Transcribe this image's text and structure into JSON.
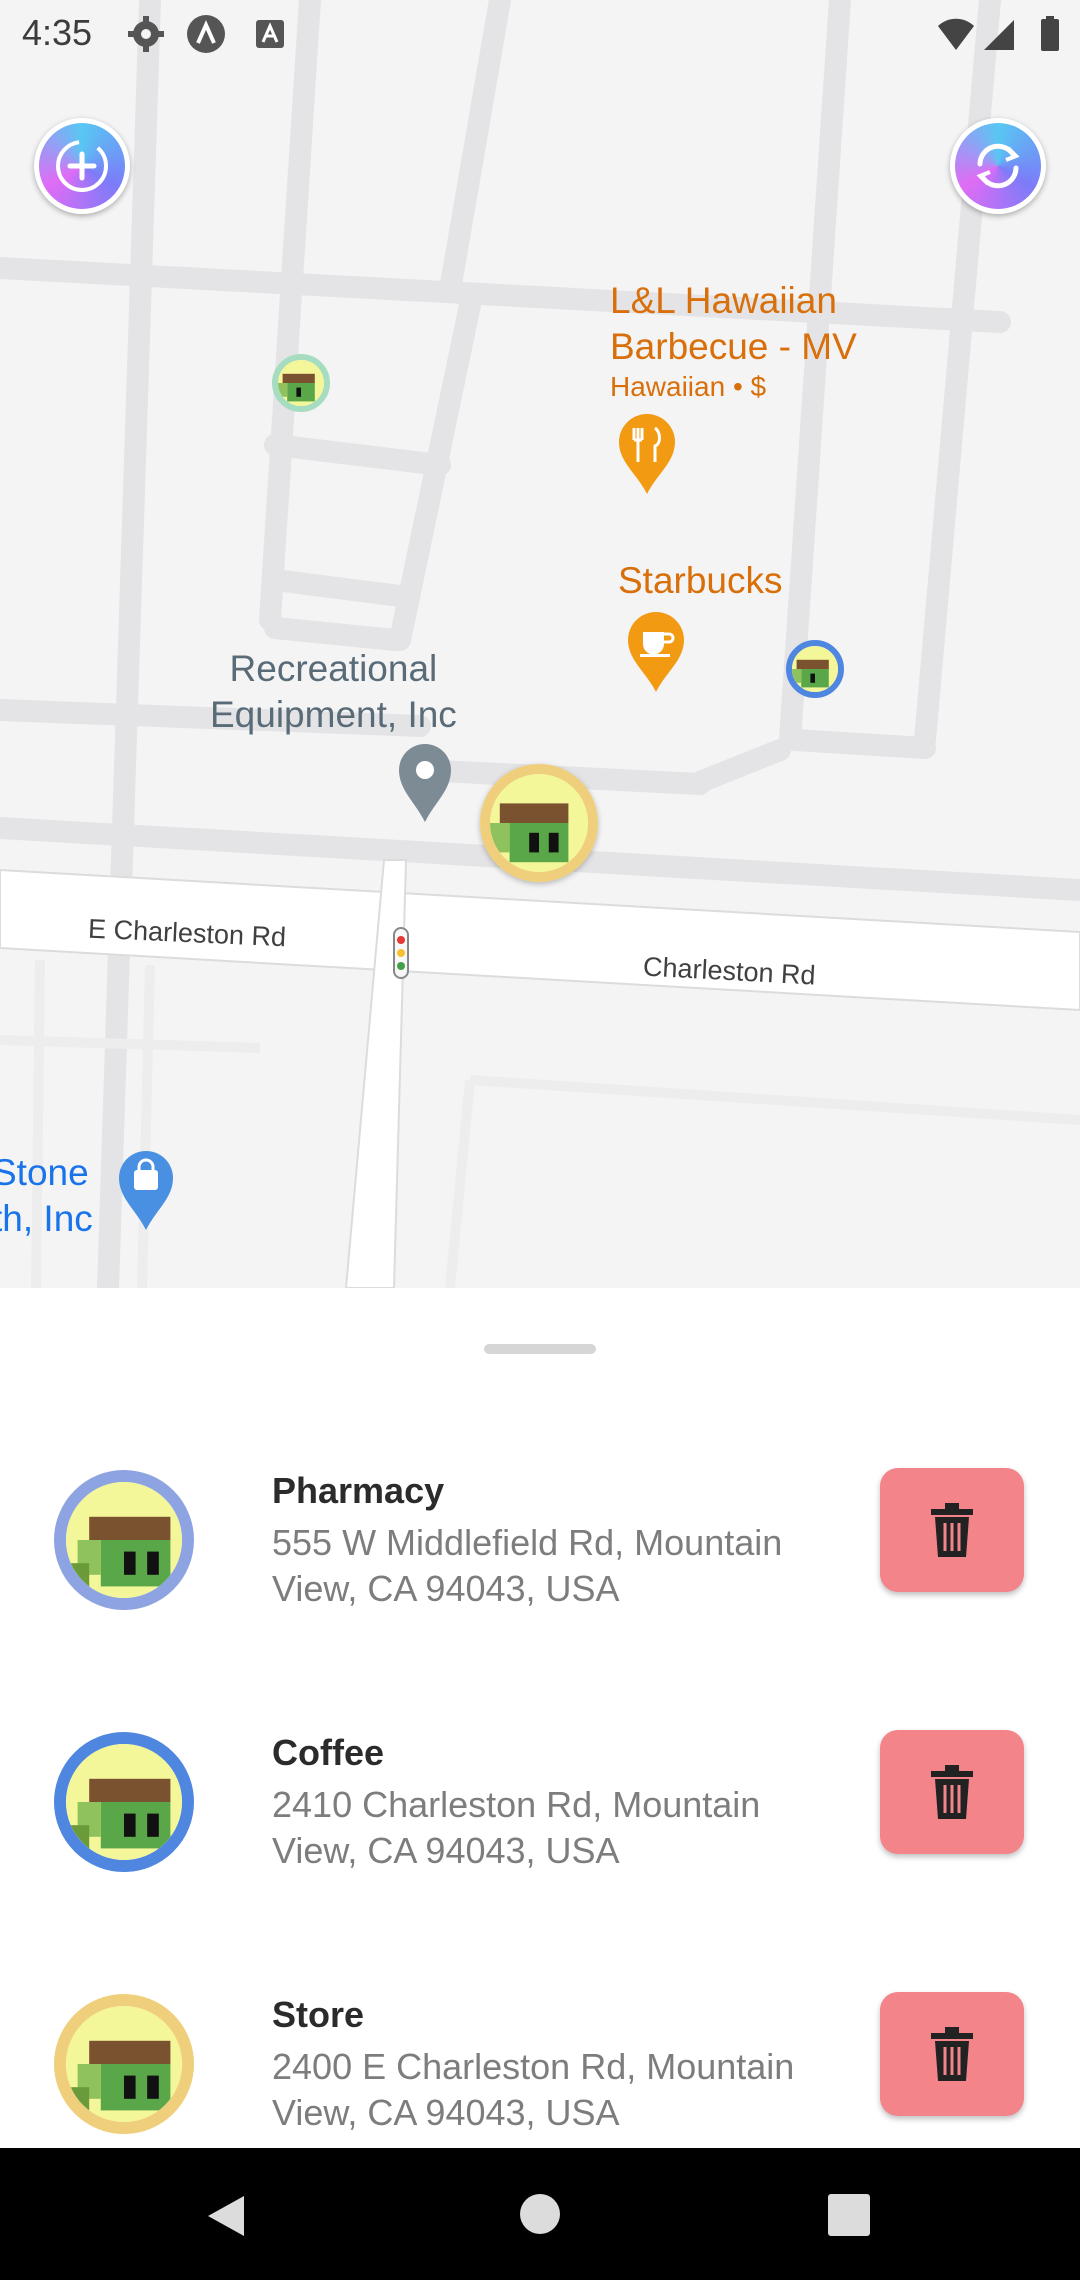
{
  "status_bar": {
    "time": "4:35"
  },
  "map": {
    "pois": [
      {
        "line1": "L&L Hawaiian",
        "line2": "Barbecue - MV",
        "sub": "Hawaiian • $",
        "color": "#d86f0a"
      },
      {
        "line1": "Starbucks",
        "color": "#d86f0a"
      },
      {
        "line1": "Recreational",
        "line2": "Equipment, Inc",
        "color": "#5a6b78"
      },
      {
        "line1": "Stone",
        "line2": "th, Inc",
        "color": "#1a73e8"
      }
    ],
    "streets": [
      "E Charleston Rd",
      "Charleston Rd"
    ]
  },
  "places": [
    {
      "name": "Pharmacy",
      "address": "555 W Middlefield Rd, Mountain View, CA 94043, USA",
      "ring_color": "#8ea4e2"
    },
    {
      "name": "Coffee",
      "address": "2410 Charleston Rd, Mountain View, CA 94043, USA",
      "ring_color": "#4f86e0"
    },
    {
      "name": "Store",
      "address": "2400 E Charleston Rd, Mountain View, CA 94043, USA",
      "ring_color": "#f0cf7c"
    }
  ],
  "colors": {
    "delete_button": "#f3848a",
    "poi_orange": "#f29a12"
  }
}
